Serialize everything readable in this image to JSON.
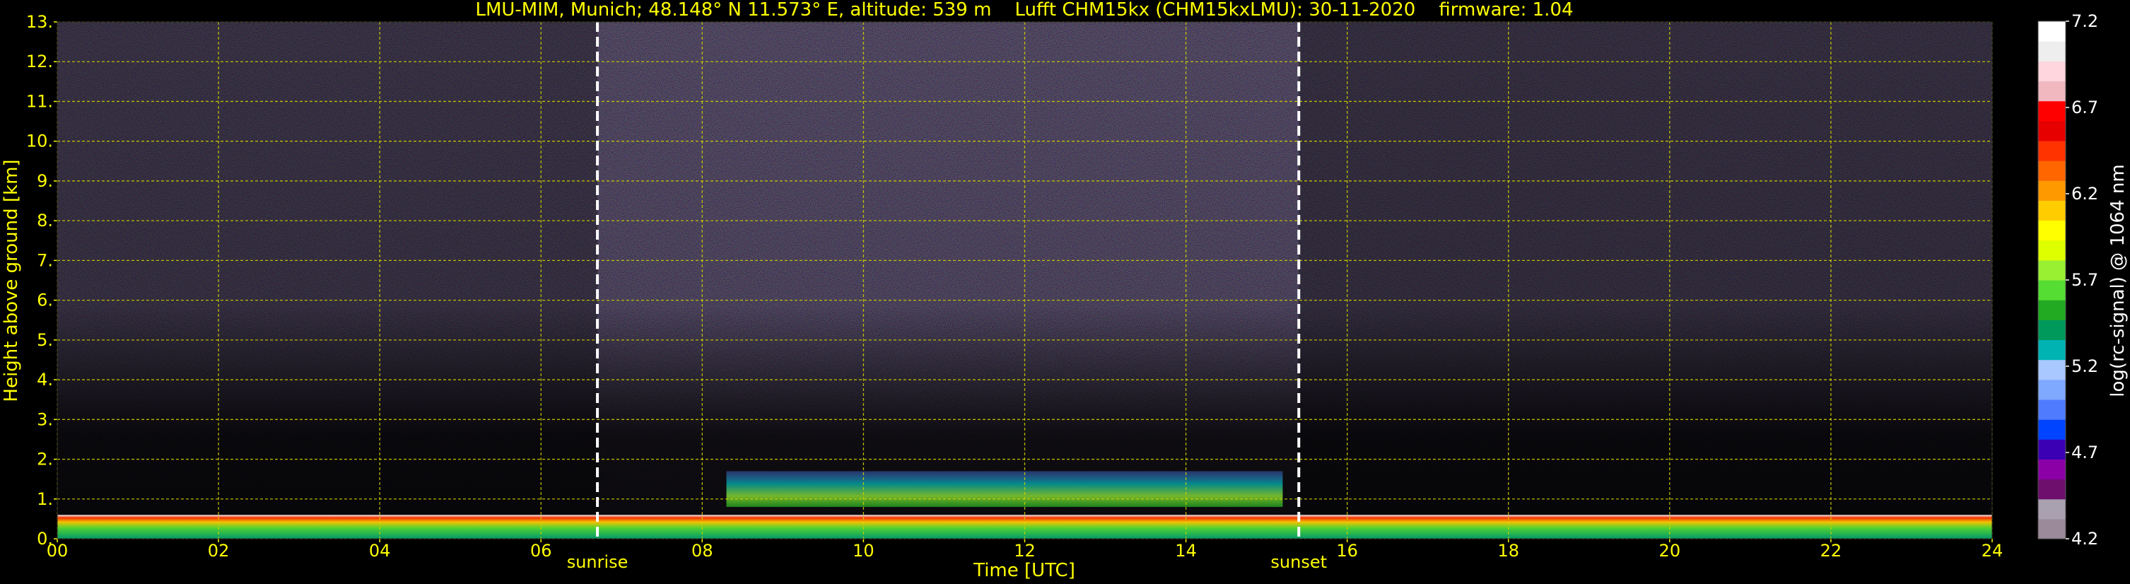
{
  "chart_data": {
    "type": "heatmap",
    "title": "LMU-MIM, Munich; 48.148° N 11.573° E, altitude: 539 m    Lufft CHM15kx (CHM15kxLMU): 30-11-2020    firmware: 1.04",
    "xlabel": "Time [UTC]",
    "ylabel": "Height above ground [km]",
    "xlim": [
      0,
      24
    ],
    "ylim": [
      0,
      13
    ],
    "x_ticks": [
      "00",
      "02",
      "04",
      "06",
      "08",
      "10",
      "12",
      "14",
      "16",
      "18",
      "20",
      "22",
      "24"
    ],
    "y_ticks": [
      "0.",
      "1.",
      "2.",
      "3.",
      "4.",
      "5.",
      "6.",
      "7.",
      "8.",
      "9.",
      "10.",
      "11.",
      "12.",
      "13."
    ],
    "grid": true,
    "annotations": [
      {
        "label": "sunrise",
        "x": 6.7
      },
      {
        "label": "sunset",
        "x": 15.4
      }
    ],
    "colorbar": {
      "label": "log(rc-signal) @ 1064 nm",
      "range": [
        4.2,
        7.2
      ],
      "ticks": [
        "4.2",
        "4.7",
        "5.2",
        "5.7",
        "6.2",
        "6.7",
        "7.2"
      ]
    },
    "layers": [
      {
        "feature": "boundary layer (strong return)",
        "x_start": 0,
        "x_end": 24,
        "height_km": [
          0.0,
          0.6
        ]
      },
      {
        "feature": "aerosol layer",
        "x_start": 8.3,
        "x_end": 15.2,
        "height_km": [
          0.8,
          1.7
        ]
      }
    ]
  },
  "colors": {
    "axis_text": "#ffff00",
    "grid": "#d4d400",
    "background": "#000000",
    "sun_lines": "#ffffff",
    "colorbar": [
      "#9a8a9a",
      "#a9a0b0",
      "#6e0f6e",
      "#8b00a6",
      "#3b00b3",
      "#0044ff",
      "#4f7cff",
      "#7fa8ff",
      "#a9c8ff",
      "#00b3b3",
      "#00995c",
      "#22aa22",
      "#55dd33",
      "#99f033",
      "#ddff00",
      "#ffff00",
      "#ffcc00",
      "#ff9900",
      "#ff6600",
      "#ff3300",
      "#e60000",
      "#ff0000",
      "#f2b8bf",
      "#ffd6de",
      "#eeeeee",
      "#ffffff"
    ]
  }
}
